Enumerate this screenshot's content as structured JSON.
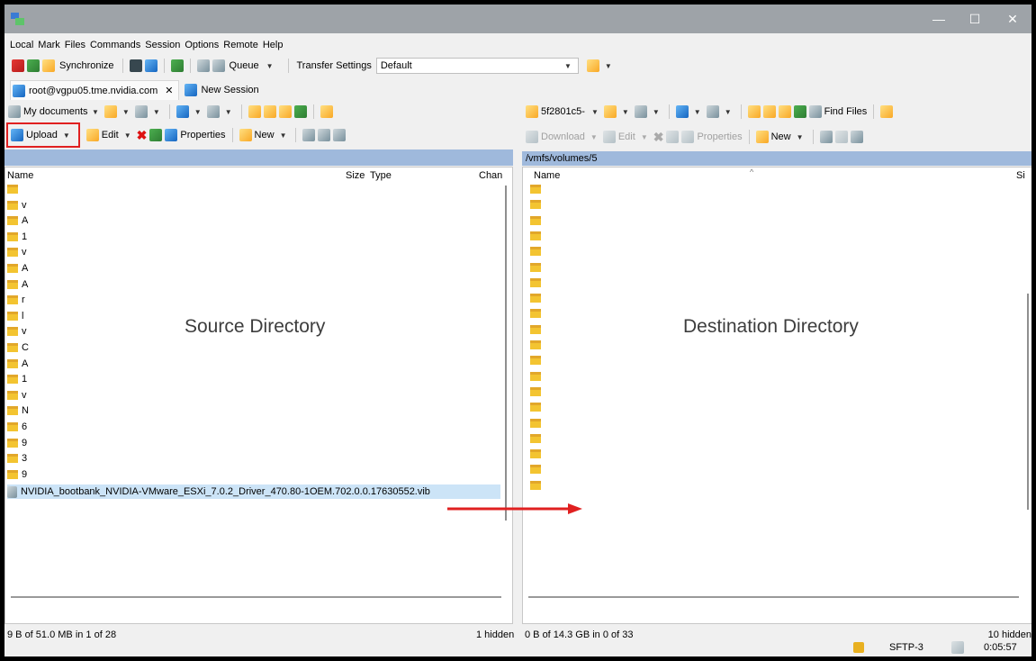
{
  "window": {
    "minimize_glyph": "—",
    "maximize_glyph": "☐",
    "close_glyph": "✕"
  },
  "menu": [
    "Local",
    "Mark",
    "Files",
    "Commands",
    "Session",
    "Options",
    "Remote",
    "Help"
  ],
  "toolbar": {
    "synchronize": "Synchronize",
    "queue": "Queue",
    "transfer_settings_label": "Transfer Settings",
    "transfer_settings_value": "Default"
  },
  "tabs": {
    "session": "root@vgpu05.tme.nvidia.com",
    "close_glyph": "✕",
    "new_session": "New Session"
  },
  "left": {
    "location": "My documents",
    "upload": "Upload",
    "edit": "Edit",
    "properties": "Properties",
    "new": "New",
    "columns": {
      "name": "Name",
      "size": "Size",
      "type": "Type",
      "changed": "Chan"
    },
    "visible_names": [
      "",
      "v",
      "A",
      "1",
      "v",
      "A",
      "A",
      "r",
      "l",
      "v",
      "C",
      "A",
      "1",
      "v",
      "N",
      "6",
      "9",
      "3",
      "9"
    ],
    "selected_file": "NVIDIA_bootbank_NVIDIA-VMware_ESXi_7.0.2_Driver_470.80-1OEM.702.0.0.17630552.vib",
    "overlay": "Source Directory",
    "status": "9 B of 51.0 MB in 1 of 28",
    "hidden": "1 hidden"
  },
  "right": {
    "location": "5f2801c5-",
    "path": "/vmfs/volumes/5",
    "download": "Download",
    "edit": "Edit",
    "properties": "Properties",
    "new": "New",
    "find_files": "Find Files",
    "columns": {
      "name": "Name",
      "size": "Si"
    },
    "folder_count": 20,
    "overlay": "Destination Directory",
    "status": "0 B of 14.3 GB in 0 of 33",
    "hidden": "10 hidden"
  },
  "statusbar": {
    "protocol": "SFTP-3",
    "elapsed": "0:05:57"
  },
  "colors": {
    "titlebar": "#9ea3a8",
    "pathbar": "#9fb9dc",
    "highlight_box": "#e02020",
    "arrow": "#e02020",
    "selection": "#cce4f7"
  }
}
